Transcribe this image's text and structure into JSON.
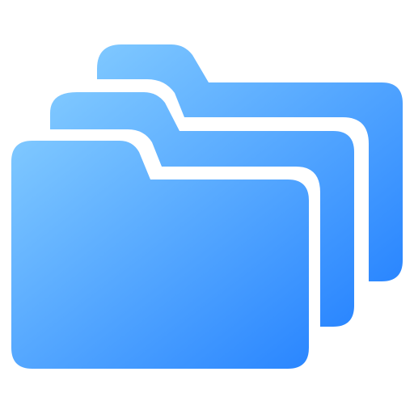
{
  "icon": {
    "name": "folders-icon",
    "colors": {
      "gradient_start": "#7FC8FF",
      "gradient_end": "#2A86FF",
      "gap": "#FFFFFF"
    }
  }
}
